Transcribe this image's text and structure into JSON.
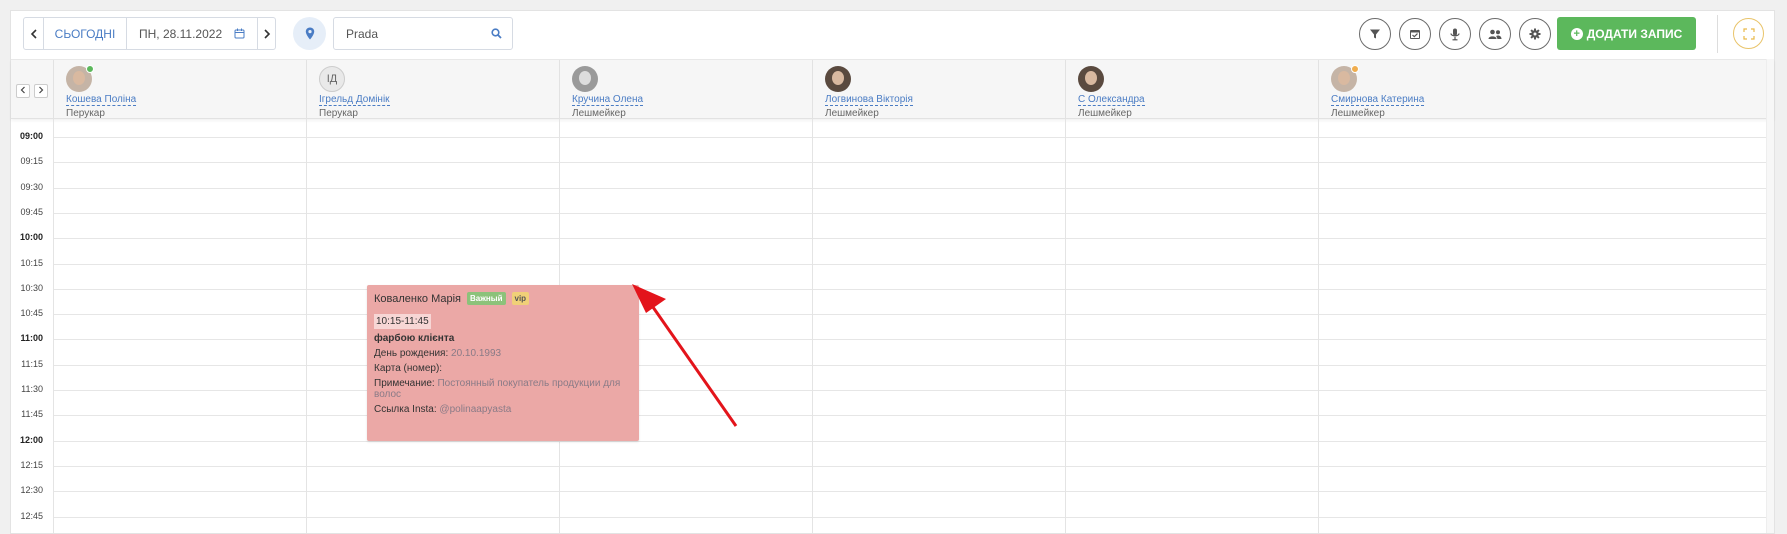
{
  "toolbar": {
    "today_label": "СЬОГОДНІ",
    "date_label": "ПН, 28.11.2022",
    "search_value": "Prada",
    "add_label": "ДОДАТИ ЗАПИС",
    "add_icon": "plus-circle-icon",
    "tool_icons": [
      "filter-icon",
      "calendar-icon",
      "microphone-icon",
      "users-icon",
      "gear-icon"
    ],
    "accent_color": "#5cb85c"
  },
  "staff": [
    {
      "name": "Кошева Поліна",
      "role": "Перукар",
      "avatar": "photo",
      "status_color": "#5cb85c"
    },
    {
      "name": "Ігрельд Домінік",
      "role": "Перукар",
      "avatar": "initials",
      "initials": "ІД"
    },
    {
      "name": "Кручина Олена",
      "role": "Лешмейкер",
      "avatar": "photo-gray"
    },
    {
      "name": "Логвинова Вікторія",
      "role": "Лешмейкер",
      "avatar": "photo"
    },
    {
      "name": "С Олександра",
      "role": "Лешмейкер",
      "avatar": "photo"
    },
    {
      "name": "Смирнова Катерина",
      "role": "Лешмейкер",
      "avatar": "photo",
      "status_color": "#f0ad4e"
    }
  ],
  "times": [
    "09:00",
    "09:15",
    "09:30",
    "09:45",
    "10:00",
    "10:15",
    "10:30",
    "10:45",
    "11:00",
    "11:15",
    "11:30",
    "11:45",
    "12:00",
    "12:15",
    "12:30",
    "12:45"
  ],
  "appointment": {
    "client": "Коваленко Марія",
    "badge_important": "Важный",
    "badge_vip": "vip",
    "time": "10:15-11:45",
    "service": "фарбою клієнта",
    "birthday_label": "День рождения:",
    "birthday_value": "20.10.1993",
    "card_label": "Карта (номер):",
    "note_label": "Примечание:",
    "note_value": "Постоянный покупатель продукции для волос",
    "insta_label": "Ссылка Insta:",
    "insta_value": "@polinaapyasta",
    "color": "#eba8a6"
  }
}
